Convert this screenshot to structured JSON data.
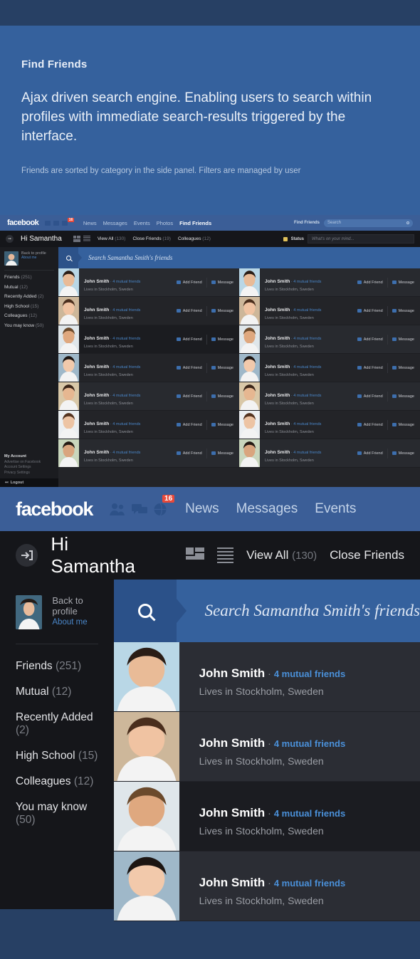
{
  "intro": {
    "title": "Find Friends",
    "lead": "Ajax driven search engine. Enabling users to search within profiles with immediate search-results triggered by the interface.",
    "sub": "Friends are sorted by category in the side panel. Filters are managed by user"
  },
  "brand": {
    "logo": "facebook",
    "accent_blue": "#35619d",
    "dark_blue": "#274064",
    "nav_blue": "#3b5e97",
    "link_blue": "#4a90d9",
    "badge_red": "#e8493a",
    "panel_dark": "#15161a",
    "row_dark": "#2b2d34"
  },
  "nav": {
    "icons": [
      "friends-icon",
      "messages-icon",
      "globe-icon"
    ],
    "badge": "16",
    "links": [
      "News",
      "Messages",
      "Events",
      "Photos",
      "Find Friends"
    ],
    "active_link": "Find Friends",
    "find_friends_label": "Find Friends",
    "search_placeholder": "Search"
  },
  "subheader": {
    "greeting": "Hi Samantha",
    "login_icon": "login-arrow-icon",
    "view_grid_icon": "grid-view-icon",
    "view_list_icon": "list-view-icon",
    "tabs": [
      {
        "label": "View All",
        "count": "(130)"
      },
      {
        "label": "Close Friends",
        "count": "(19)"
      },
      {
        "label": "Colleagues",
        "count": "(12)"
      }
    ],
    "status_label": "Status",
    "status_placeholder": "What's on your mind..."
  },
  "sidebar": {
    "back_to_profile": "Back to profile",
    "about_me": "About me",
    "categories": [
      {
        "label": "Friends",
        "count": "(251)"
      },
      {
        "label": "Mutual",
        "count": "(12)"
      },
      {
        "label": "Recently Added",
        "count": "(2)"
      },
      {
        "label": "High School",
        "count": "(15)"
      },
      {
        "label": "Colleagues",
        "count": "(12)"
      },
      {
        "label": "You may know",
        "count": "(50)"
      }
    ],
    "account": {
      "heading": "My Account",
      "links": [
        "Advertise on Facebook",
        "Account Settings",
        "Privacy Settings"
      ],
      "logout": "Logout"
    }
  },
  "search": {
    "placeholder": "Search Samantha Smith's friends",
    "icon": "magnifier-icon"
  },
  "friend": {
    "name": "John Smith",
    "mutual": "4 mutual friends",
    "lives": "Lives in Stockholm, Sweden",
    "dot": "·",
    "add_friend": "Add Friend",
    "message": "Message"
  },
  "mock_rows_left": [
    {
      "tone": "alt"
    },
    {
      "tone": "plain"
    },
    {
      "tone": "dark"
    },
    {
      "tone": "plain"
    },
    {
      "tone": "alt"
    },
    {
      "tone": "plain"
    },
    {
      "tone": "alt"
    }
  ],
  "mock_rows_right": [
    {
      "tone": "alt"
    },
    {
      "tone": "plain"
    },
    {
      "tone": "alt"
    },
    {
      "tone": "plain"
    },
    {
      "tone": "alt"
    },
    {
      "tone": "plain"
    },
    {
      "tone": "alt"
    }
  ],
  "big_rows": [
    {
      "tone": "plain"
    },
    {
      "tone": "plain"
    },
    {
      "tone": "dark"
    },
    {
      "tone": "plain"
    }
  ]
}
